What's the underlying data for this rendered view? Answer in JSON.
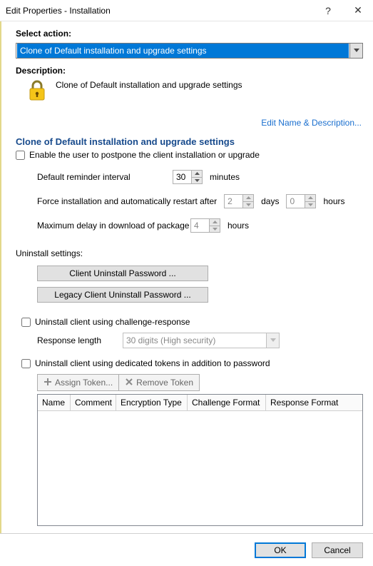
{
  "window": {
    "title": "Edit Properties - Installation",
    "help": "?",
    "close": "✕"
  },
  "select_action_label": "Select action:",
  "select_action_value": "Clone of Default installation and upgrade settings",
  "description_label": "Description:",
  "description_text": "Clone of Default installation and upgrade settings",
  "edit_link": "Edit Name & Description...",
  "section_heading": "Clone of Default installation and upgrade settings",
  "postpone_checkbox_label": "Enable the user to postpone the client installation or upgrade",
  "reminder": {
    "label": "Default reminder interval",
    "value": "30",
    "unit": "minutes"
  },
  "force": {
    "label": "Force installation and automatically restart after",
    "days_value": "2",
    "days_unit": "days",
    "hours_value": "0",
    "hours_unit": "hours"
  },
  "maxdelay": {
    "label": "Maximum delay in download of package",
    "value": "4",
    "unit": "hours"
  },
  "uninstall_heading": "Uninstall settings:",
  "btn_client_uninstall": "Client Uninstall Password ...",
  "btn_legacy_uninstall": "Legacy Client Uninstall Password ...",
  "challenge_checkbox_label": "Uninstall client using challenge-response",
  "response_length_label": "Response length",
  "response_length_value": "30 digits (High security)",
  "tokens_checkbox_label": "Uninstall client using dedicated tokens in addition to password",
  "assign_token_label": "Assign Token...",
  "remove_token_label": "Remove Token",
  "grid_headers": {
    "name": "Name",
    "comment": "Comment",
    "encryption": "Encryption Type",
    "challenge": "Challenge Format",
    "response": "Response Format"
  },
  "footer": {
    "ok": "OK",
    "cancel": "Cancel"
  }
}
